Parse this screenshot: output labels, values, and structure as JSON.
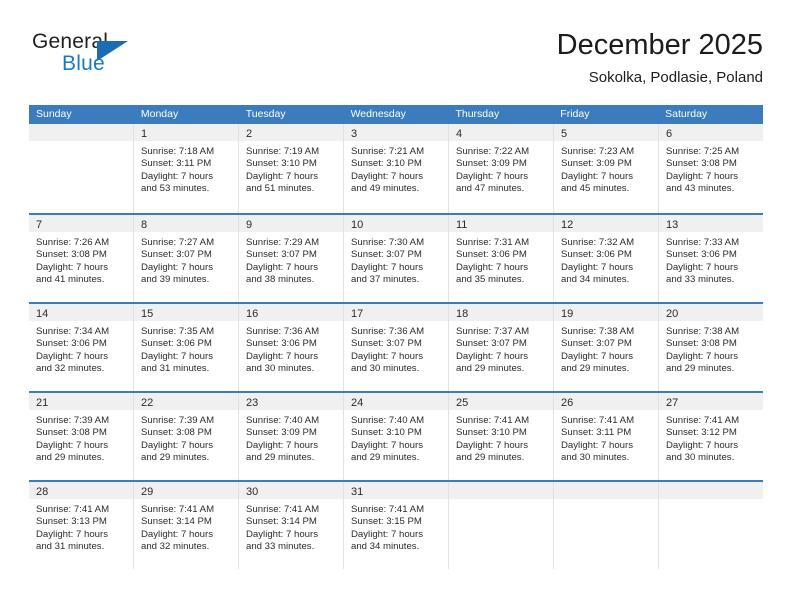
{
  "brand": {
    "name_part1": "General",
    "name_part2": "Blue",
    "accent_color": "#1b6cb3"
  },
  "header": {
    "title": "December 2025",
    "subtitle": "Sokolka, Podlasie, Poland"
  },
  "calendar": {
    "header_bg": "#3a7cbe",
    "weekday_headers": [
      "Sunday",
      "Monday",
      "Tuesday",
      "Wednesday",
      "Thursday",
      "Friday",
      "Saturday"
    ],
    "weeks": [
      [
        {
          "day": "",
          "sunrise": "",
          "sunset": "",
          "daylight_line1": "",
          "daylight_line2": ""
        },
        {
          "day": "1",
          "sunrise": "Sunrise: 7:18 AM",
          "sunset": "Sunset: 3:11 PM",
          "daylight_line1": "Daylight: 7 hours",
          "daylight_line2": "and 53 minutes."
        },
        {
          "day": "2",
          "sunrise": "Sunrise: 7:19 AM",
          "sunset": "Sunset: 3:10 PM",
          "daylight_line1": "Daylight: 7 hours",
          "daylight_line2": "and 51 minutes."
        },
        {
          "day": "3",
          "sunrise": "Sunrise: 7:21 AM",
          "sunset": "Sunset: 3:10 PM",
          "daylight_line1": "Daylight: 7 hours",
          "daylight_line2": "and 49 minutes."
        },
        {
          "day": "4",
          "sunrise": "Sunrise: 7:22 AM",
          "sunset": "Sunset: 3:09 PM",
          "daylight_line1": "Daylight: 7 hours",
          "daylight_line2": "and 47 minutes."
        },
        {
          "day": "5",
          "sunrise": "Sunrise: 7:23 AM",
          "sunset": "Sunset: 3:09 PM",
          "daylight_line1": "Daylight: 7 hours",
          "daylight_line2": "and 45 minutes."
        },
        {
          "day": "6",
          "sunrise": "Sunrise: 7:25 AM",
          "sunset": "Sunset: 3:08 PM",
          "daylight_line1": "Daylight: 7 hours",
          "daylight_line2": "and 43 minutes."
        }
      ],
      [
        {
          "day": "7",
          "sunrise": "Sunrise: 7:26 AM",
          "sunset": "Sunset: 3:08 PM",
          "daylight_line1": "Daylight: 7 hours",
          "daylight_line2": "and 41 minutes."
        },
        {
          "day": "8",
          "sunrise": "Sunrise: 7:27 AM",
          "sunset": "Sunset: 3:07 PM",
          "daylight_line1": "Daylight: 7 hours",
          "daylight_line2": "and 39 minutes."
        },
        {
          "day": "9",
          "sunrise": "Sunrise: 7:29 AM",
          "sunset": "Sunset: 3:07 PM",
          "daylight_line1": "Daylight: 7 hours",
          "daylight_line2": "and 38 minutes."
        },
        {
          "day": "10",
          "sunrise": "Sunrise: 7:30 AM",
          "sunset": "Sunset: 3:07 PM",
          "daylight_line1": "Daylight: 7 hours",
          "daylight_line2": "and 37 minutes."
        },
        {
          "day": "11",
          "sunrise": "Sunrise: 7:31 AM",
          "sunset": "Sunset: 3:06 PM",
          "daylight_line1": "Daylight: 7 hours",
          "daylight_line2": "and 35 minutes."
        },
        {
          "day": "12",
          "sunrise": "Sunrise: 7:32 AM",
          "sunset": "Sunset: 3:06 PM",
          "daylight_line1": "Daylight: 7 hours",
          "daylight_line2": "and 34 minutes."
        },
        {
          "day": "13",
          "sunrise": "Sunrise: 7:33 AM",
          "sunset": "Sunset: 3:06 PM",
          "daylight_line1": "Daylight: 7 hours",
          "daylight_line2": "and 33 minutes."
        }
      ],
      [
        {
          "day": "14",
          "sunrise": "Sunrise: 7:34 AM",
          "sunset": "Sunset: 3:06 PM",
          "daylight_line1": "Daylight: 7 hours",
          "daylight_line2": "and 32 minutes."
        },
        {
          "day": "15",
          "sunrise": "Sunrise: 7:35 AM",
          "sunset": "Sunset: 3:06 PM",
          "daylight_line1": "Daylight: 7 hours",
          "daylight_line2": "and 31 minutes."
        },
        {
          "day": "16",
          "sunrise": "Sunrise: 7:36 AM",
          "sunset": "Sunset: 3:06 PM",
          "daylight_line1": "Daylight: 7 hours",
          "daylight_line2": "and 30 minutes."
        },
        {
          "day": "17",
          "sunrise": "Sunrise: 7:36 AM",
          "sunset": "Sunset: 3:07 PM",
          "daylight_line1": "Daylight: 7 hours",
          "daylight_line2": "and 30 minutes."
        },
        {
          "day": "18",
          "sunrise": "Sunrise: 7:37 AM",
          "sunset": "Sunset: 3:07 PM",
          "daylight_line1": "Daylight: 7 hours",
          "daylight_line2": "and 29 minutes."
        },
        {
          "day": "19",
          "sunrise": "Sunrise: 7:38 AM",
          "sunset": "Sunset: 3:07 PM",
          "daylight_line1": "Daylight: 7 hours",
          "daylight_line2": "and 29 minutes."
        },
        {
          "day": "20",
          "sunrise": "Sunrise: 7:38 AM",
          "sunset": "Sunset: 3:08 PM",
          "daylight_line1": "Daylight: 7 hours",
          "daylight_line2": "and 29 minutes."
        }
      ],
      [
        {
          "day": "21",
          "sunrise": "Sunrise: 7:39 AM",
          "sunset": "Sunset: 3:08 PM",
          "daylight_line1": "Daylight: 7 hours",
          "daylight_line2": "and 29 minutes."
        },
        {
          "day": "22",
          "sunrise": "Sunrise: 7:39 AM",
          "sunset": "Sunset: 3:08 PM",
          "daylight_line1": "Daylight: 7 hours",
          "daylight_line2": "and 29 minutes."
        },
        {
          "day": "23",
          "sunrise": "Sunrise: 7:40 AM",
          "sunset": "Sunset: 3:09 PM",
          "daylight_line1": "Daylight: 7 hours",
          "daylight_line2": "and 29 minutes."
        },
        {
          "day": "24",
          "sunrise": "Sunrise: 7:40 AM",
          "sunset": "Sunset: 3:10 PM",
          "daylight_line1": "Daylight: 7 hours",
          "daylight_line2": "and 29 minutes."
        },
        {
          "day": "25",
          "sunrise": "Sunrise: 7:41 AM",
          "sunset": "Sunset: 3:10 PM",
          "daylight_line1": "Daylight: 7 hours",
          "daylight_line2": "and 29 minutes."
        },
        {
          "day": "26",
          "sunrise": "Sunrise: 7:41 AM",
          "sunset": "Sunset: 3:11 PM",
          "daylight_line1": "Daylight: 7 hours",
          "daylight_line2": "and 30 minutes."
        },
        {
          "day": "27",
          "sunrise": "Sunrise: 7:41 AM",
          "sunset": "Sunset: 3:12 PM",
          "daylight_line1": "Daylight: 7 hours",
          "daylight_line2": "and 30 minutes."
        }
      ],
      [
        {
          "day": "28",
          "sunrise": "Sunrise: 7:41 AM",
          "sunset": "Sunset: 3:13 PM",
          "daylight_line1": "Daylight: 7 hours",
          "daylight_line2": "and 31 minutes."
        },
        {
          "day": "29",
          "sunrise": "Sunrise: 7:41 AM",
          "sunset": "Sunset: 3:14 PM",
          "daylight_line1": "Daylight: 7 hours",
          "daylight_line2": "and 32 minutes."
        },
        {
          "day": "30",
          "sunrise": "Sunrise: 7:41 AM",
          "sunset": "Sunset: 3:14 PM",
          "daylight_line1": "Daylight: 7 hours",
          "daylight_line2": "and 33 minutes."
        },
        {
          "day": "31",
          "sunrise": "Sunrise: 7:41 AM",
          "sunset": "Sunset: 3:15 PM",
          "daylight_line1": "Daylight: 7 hours",
          "daylight_line2": "and 34 minutes."
        },
        {
          "day": "",
          "sunrise": "",
          "sunset": "",
          "daylight_line1": "",
          "daylight_line2": ""
        },
        {
          "day": "",
          "sunrise": "",
          "sunset": "",
          "daylight_line1": "",
          "daylight_line2": ""
        },
        {
          "day": "",
          "sunrise": "",
          "sunset": "",
          "daylight_line1": "",
          "daylight_line2": ""
        }
      ]
    ]
  }
}
